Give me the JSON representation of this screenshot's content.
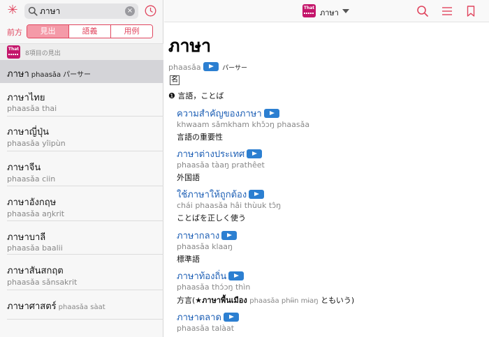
{
  "search": {
    "query": "ภาษา",
    "clear_glyph": "×"
  },
  "segment": {
    "label": "前方",
    "options": [
      "見出",
      "語義",
      "用例"
    ]
  },
  "results": {
    "logo_text": "That",
    "count_text": "8項目の見出"
  },
  "list": [
    {
      "thai": "ภาษา",
      "roman": "phaasǎa",
      "kana": "パーサー",
      "selected": true
    },
    {
      "thai": "ภาษาไทย",
      "roman": "phaasǎa thai"
    },
    {
      "thai": "ภาษาญี่ปุ่น",
      "roman": "phaasǎa yîipùn"
    },
    {
      "thai": "ภาษาจีน",
      "roman": "phaasǎa ciin"
    },
    {
      "thai": "ภาษาอังกฤษ",
      "roman": "phaasǎa aŋkrit"
    },
    {
      "thai": "ภาษาบาลี",
      "roman": "phaasǎa baalii"
    },
    {
      "thai": "ภาษาสันสกฤต",
      "roman": "phaasǎa sǎnsakrit"
    },
    {
      "thai": "ภาษาศาสตร์",
      "roman": "phaasǎa sàat"
    }
  ],
  "toolbar": {
    "dict_logo_text": "That",
    "dict_title": "ภาษา"
  },
  "entry": {
    "headword": "ภาษา",
    "roman": "phaasǎa",
    "kana": "パーサー",
    "pos": "名",
    "sense": "❶ 言語，ことば",
    "examples": [
      {
        "thai": "ความสำคัญของภาษา",
        "roman": "khwaam sǎmkham khɔ̌ɔŋ phaasǎa",
        "ja": "言語の重要性"
      },
      {
        "thai": "ภาษาต่างประเทศ",
        "roman": "phaasǎa tàaŋ prathêet",
        "ja": "外国語"
      },
      {
        "thai": "ใช้ภาษาให้ถูกต้อง",
        "roman": "chái phaasǎa hâi thùuk tɔ̂ŋ",
        "ja": "ことばを正しく使う"
      },
      {
        "thai": "ภาษากลาง",
        "roman": "phaasǎa klaaŋ",
        "ja": "標準語"
      },
      {
        "thai": "ภาษาท้องถิ่น",
        "roman": "phaasǎa thɔ́ɔŋ thìn",
        "ja": "方言(",
        "note_thai": "★ภาษาพื้นเมือง",
        "note_roman": "phaasǎa phɨ́ɨn mɨaŋ",
        "ja_tail": "ともいう)"
      },
      {
        "thai": "ภาษาตลาด",
        "roman": "phaasǎa talàat",
        "ja": ""
      }
    ]
  },
  "colors": {
    "accent": "#e0455e",
    "link": "#1d5fb5",
    "play": "#2c7fd1",
    "brand": "#c4166b"
  }
}
